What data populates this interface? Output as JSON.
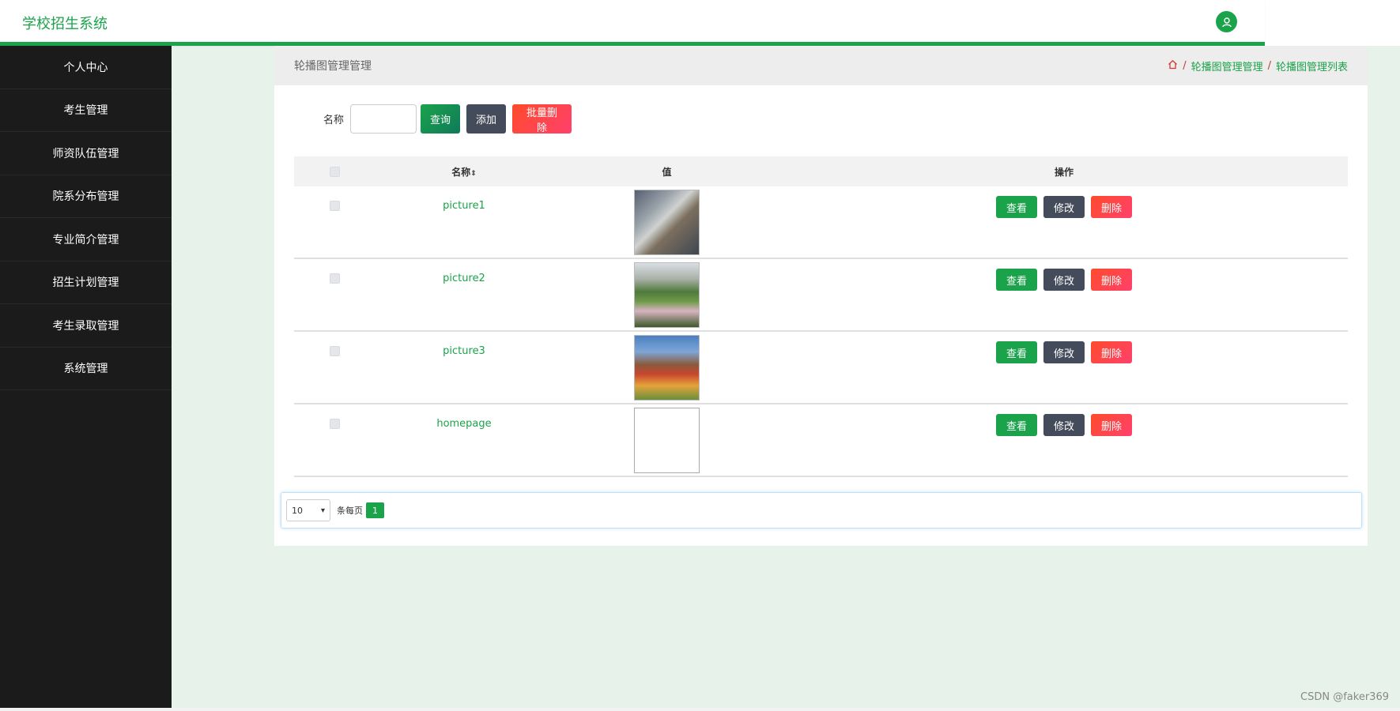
{
  "app": {
    "title": "学校招生系统"
  },
  "sidebar": {
    "items": [
      {
        "label": "个人中心"
      },
      {
        "label": "考生管理"
      },
      {
        "label": "师资队伍管理"
      },
      {
        "label": "院系分布管理"
      },
      {
        "label": "专业简介管理"
      },
      {
        "label": "招生计划管理"
      },
      {
        "label": "考生录取管理"
      },
      {
        "label": "系统管理"
      }
    ]
  },
  "panel": {
    "title": "轮播图管理管理",
    "breadcrumb": [
      "轮播图管理管理",
      "轮播图管理列表"
    ],
    "breadcrumb_sep": "/"
  },
  "toolbar": {
    "name_label": "名称",
    "search_value": "",
    "query_label": "查询",
    "add_label": "添加",
    "batch_delete_label": "批量删除"
  },
  "table": {
    "headers": {
      "name": "名称",
      "value": "值",
      "ops": "操作"
    },
    "rows": [
      {
        "name": "picture1"
      },
      {
        "name": "picture2"
      },
      {
        "name": "picture3"
      },
      {
        "name": "homepage"
      }
    ],
    "actions": {
      "view": "查看",
      "edit": "修改",
      "delete": "删除"
    }
  },
  "pagination": {
    "page_size": "10",
    "per_page_label": "条每页",
    "current_page": "1"
  },
  "watermark": "CSDN @faker369",
  "colors": {
    "accent": "#1aa34a",
    "sidebar_bg": "#1b1b1b",
    "content_bg": "#e6f2ea",
    "edit_btn": "#444b5a",
    "delete_btn": "#ff416c"
  }
}
